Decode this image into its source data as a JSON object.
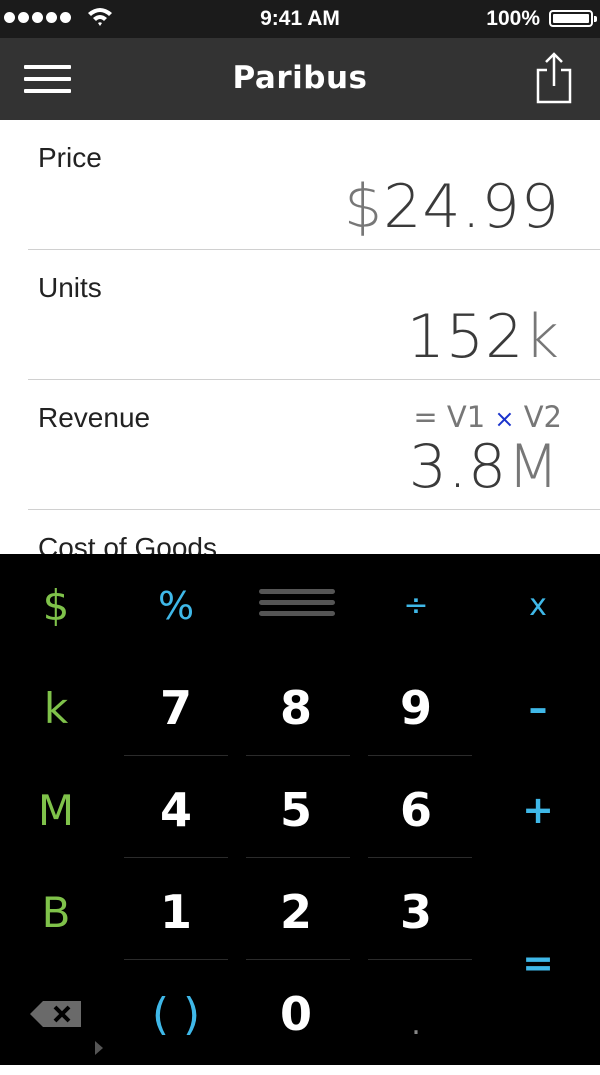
{
  "status": {
    "time": "9:41 AM",
    "battery": "100%"
  },
  "nav": {
    "title": "Paribus"
  },
  "rows": [
    {
      "label": "Price",
      "value_symbol": "$",
      "value": "24.99"
    },
    {
      "label": "Units",
      "value_main": "152",
      "value_suffix": "k"
    },
    {
      "label": "Revenue",
      "formula_left": "= V1",
      "formula_op": "×",
      "formula_right": "V2",
      "value_main": "3.8",
      "value_suffix": "M"
    },
    {
      "label": "Cost of Goods"
    }
  ],
  "keypad": {
    "dollar": "$",
    "percent": "%",
    "divide": "÷",
    "multiply": "x",
    "k": "k",
    "seven": "7",
    "eight": "8",
    "nine": "9",
    "minus": "–",
    "M": "M",
    "four": "4",
    "five": "5",
    "six": "6",
    "plus": "+",
    "B": "B",
    "one": "1",
    "two": "2",
    "three": "3",
    "equals": "=",
    "parens": "( )",
    "zero": "0",
    "decimal": "."
  },
  "colors": {
    "accent_green": "#7fc24a",
    "accent_blue": "#3fb8e8",
    "formula_operator": "#1a33cc",
    "navbar": "#333333"
  }
}
